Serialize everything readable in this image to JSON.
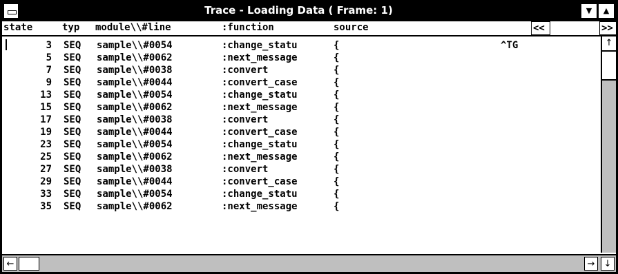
{
  "window": {
    "title": "Trace - Loading Data ( Frame: 1)",
    "minimize_glyph": "▼",
    "maximize_glyph": "▲"
  },
  "header": {
    "columns": {
      "state": "state",
      "typ": "typ",
      "module": "module\\\\#line",
      "function": ":function",
      "source": "source"
    },
    "scroll_left": "<<",
    "scroll_right": ">>"
  },
  "rows": [
    {
      "state": "3",
      "typ": "SEQ",
      "module": "sample\\\\#0054",
      "function": ":change_statu",
      "source": "{",
      "extra": "^TG"
    },
    {
      "state": "5",
      "typ": "SEQ",
      "module": "sample\\\\#0062",
      "function": ":next_message",
      "source": "{",
      "extra": ""
    },
    {
      "state": "7",
      "typ": "SEQ",
      "module": "sample\\\\#0038",
      "function": ":convert",
      "source": "{",
      "extra": ""
    },
    {
      "state": "9",
      "typ": "SEQ",
      "module": "sample\\\\#0044",
      "function": ":convert_case",
      "source": "{",
      "extra": ""
    },
    {
      "state": "13",
      "typ": "SEQ",
      "module": "sample\\\\#0054",
      "function": ":change_statu",
      "source": "{",
      "extra": ""
    },
    {
      "state": "15",
      "typ": "SEQ",
      "module": "sample\\\\#0062",
      "function": ":next_message",
      "source": "{",
      "extra": ""
    },
    {
      "state": "17",
      "typ": "SEQ",
      "module": "sample\\\\#0038",
      "function": ":convert",
      "source": "{",
      "extra": ""
    },
    {
      "state": "19",
      "typ": "SEQ",
      "module": "sample\\\\#0044",
      "function": ":convert_case",
      "source": "{",
      "extra": ""
    },
    {
      "state": "23",
      "typ": "SEQ",
      "module": "sample\\\\#0054",
      "function": ":change_statu",
      "source": "{",
      "extra": ""
    },
    {
      "state": "25",
      "typ": "SEQ",
      "module": "sample\\\\#0062",
      "function": ":next_message",
      "source": "{",
      "extra": ""
    },
    {
      "state": "27",
      "typ": "SEQ",
      "module": "sample\\\\#0038",
      "function": ":convert",
      "source": "{",
      "extra": ""
    },
    {
      "state": "29",
      "typ": "SEQ",
      "module": "sample\\\\#0044",
      "function": ":convert_case",
      "source": "{",
      "extra": ""
    },
    {
      "state": "33",
      "typ": "SEQ",
      "module": "sample\\\\#0054",
      "function": ":change_statu",
      "source": "{",
      "extra": ""
    },
    {
      "state": "35",
      "typ": "SEQ",
      "module": "sample\\\\#0062",
      "function": ":next_message",
      "source": "{",
      "extra": ""
    }
  ],
  "scrollbars": {
    "up_glyph": "↑",
    "left_glyph": "←",
    "right_glyph": "→",
    "down_glyph": "↓"
  }
}
